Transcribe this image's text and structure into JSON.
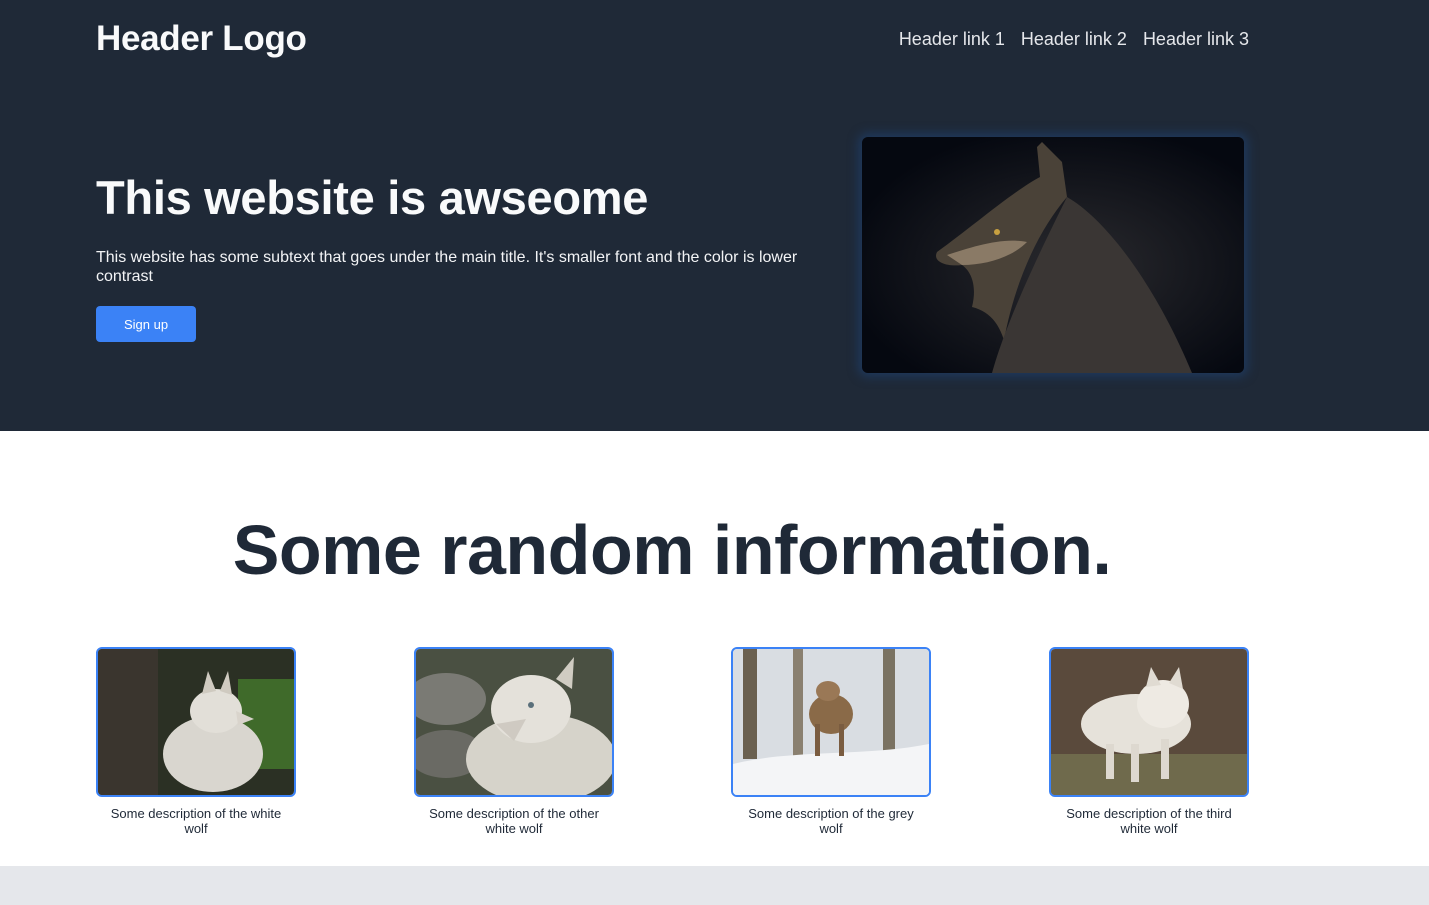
{
  "header": {
    "logo": "Header Logo",
    "links": [
      "Header link 1",
      "Header link 2",
      "Header link 3"
    ]
  },
  "hero": {
    "title": "This website is awseome",
    "subtitle": "This website has some subtext that goes under the main title. It's smaller font and the color is lower contrast",
    "button_label": "Sign up"
  },
  "info": {
    "title": "Some random information."
  },
  "cards": [
    {
      "description": "Some description of the white wolf"
    },
    {
      "description": "Some description of the other white wolf"
    },
    {
      "description": "Some description of the grey wolf"
    },
    {
      "description": "Some description of the third white wolf"
    }
  ],
  "colors": {
    "hero_background": "#1f2937",
    "accent": "#3b82f6",
    "footer_background": "#e5e7eb"
  }
}
